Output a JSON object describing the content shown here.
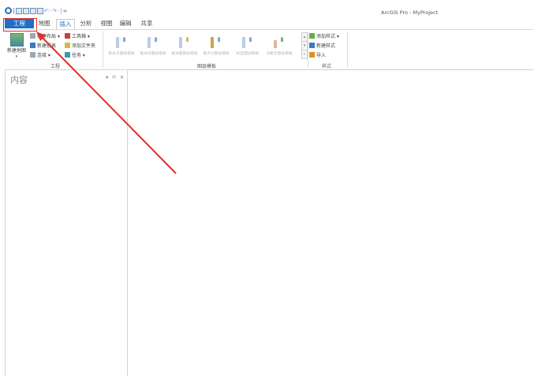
{
  "window": {
    "title": "ArcGIS Pro - MyProject"
  },
  "qat": {
    "separator": "|",
    "customize": "≑"
  },
  "tabs": [
    {
      "label": "工程"
    },
    {
      "label": "地图"
    },
    {
      "label": "插入"
    },
    {
      "label": "分析"
    },
    {
      "label": "视图"
    },
    {
      "label": "编辑"
    },
    {
      "label": "共享"
    }
  ],
  "ribbon": {
    "project_group": {
      "label": "工程",
      "new_map": "新建地图",
      "new_layout": "新建布局 ▾",
      "new_report": "新建报表",
      "connections": "连接 ▾",
      "toolbox": "工具箱 ▾",
      "add_folder": "添加文件夹",
      "tasks": "任务 ▾"
    },
    "layer_templates": {
      "label": "图层模板",
      "items": [
        {
          "label": "基本点图层模板"
        },
        {
          "label": "基本线图层模板"
        },
        {
          "label": "基本面图层模板"
        },
        {
          "label": "重点分图层模板"
        },
        {
          "label": "标签图层模板"
        },
        {
          "label": "点聚合图层模板"
        }
      ]
    },
    "styles": {
      "label": "样式",
      "add_style": "添加样式 ▾",
      "new_style": "新建样式",
      "import": "导入"
    },
    "gallery_scroll": {
      "up": "▴",
      "down": "▾",
      "more": "▿"
    }
  },
  "contents_pane": {
    "title": "内容",
    "menu": "▾",
    "pin": "⊓",
    "close": "✕"
  },
  "annotation": {
    "color": "#e03030"
  }
}
